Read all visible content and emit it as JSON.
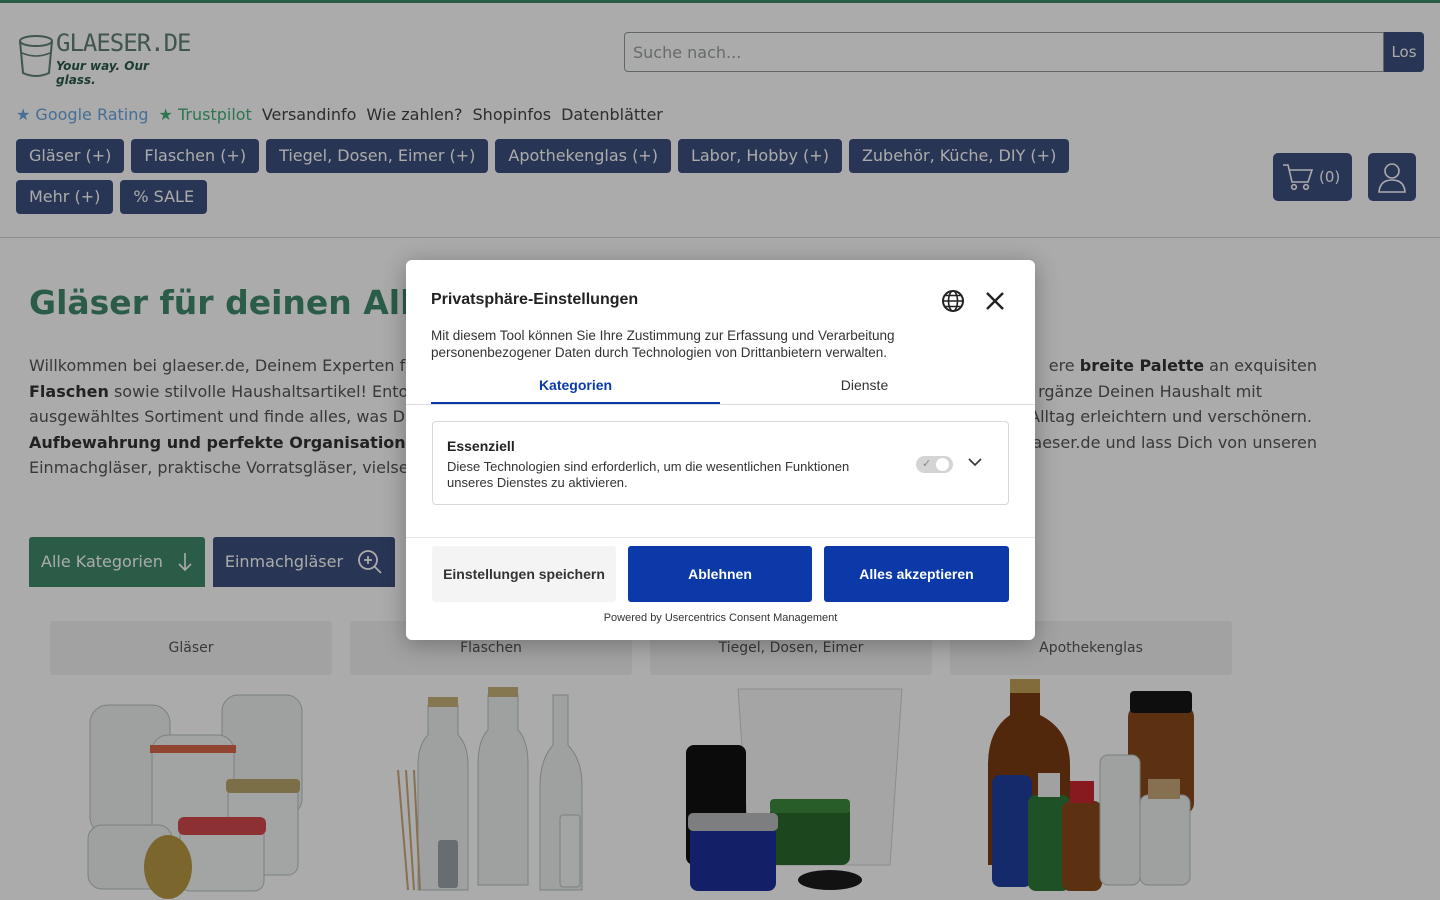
{
  "brand": {
    "name": "GLAESER.DE",
    "tagline": "Your way. Our glass."
  },
  "search": {
    "placeholder": "Suche nach...",
    "button": "Los"
  },
  "toplinks": [
    {
      "label": "★ Google Rating"
    },
    {
      "label": "★ Trustpilot"
    },
    {
      "label": "Versandinfo"
    },
    {
      "label": "Wie zahlen?"
    },
    {
      "label": "Shopinfos"
    },
    {
      "label": "Datenblätter"
    }
  ],
  "categories": [
    "Gläser (+)",
    "Flaschen (+)",
    "Tiegel, Dosen, Eimer (+)",
    "Apothekenglas (+)",
    "Labor, Hobby (+)",
    "Zubehör, Küche, DIY (+)",
    "Mehr (+)",
    "% SALE"
  ],
  "cart": {
    "count": "(0)"
  },
  "main": {
    "title": "Gläser für deinen Allta",
    "intro": {
      "l1a": "Willkommen bei glaeser.de, Deinem Experten f",
      "l1b": "ere ",
      "l1c": "breite Palette",
      "l1d": " an exquisiten",
      "l2a": "Flaschen",
      "l2b": " sowie stilvolle Haushaltsartikel! Ento",
      "l2c": "rgänze Deinen Haushalt mit",
      "l3a": "ausgewähltes Sortiment und finde alles, was D",
      "l3b": "Alltag erleichtern und verschönern.",
      "l4a": "Aufbewahrung und perfekte Organisation",
      "l4b": "aeser.de und lass Dich von unseren",
      "l5a": "Einmachgläser, praktische Vorratsgläser, vielse"
    },
    "tabs": {
      "all": "Alle Kategorien",
      "search": "Einmachgläser"
    },
    "tiles": [
      "Gläser",
      "Flaschen",
      "Tiegel, Dosen, Eimer",
      "Apothekenglas"
    ]
  },
  "consent": {
    "title": "Privatsphäre-Einstellungen",
    "description": "Mit diesem Tool können Sie Ihre Zustimmung zur Erfassung und Verarbeitung personenbezogener Daten durch Technologien von Drittanbietern verwalten.",
    "tab_categories": "Kategorien",
    "tab_services": "Dienste",
    "essential_title": "Essenziell",
    "essential_desc": "Diese Technologien sind erforderlich, um die wesentlichen Funktionen unseres Dienstes zu aktivieren.",
    "btn_save": "Einstellungen speichern",
    "btn_deny": "Ablehnen",
    "btn_accept": "Alles akzeptieren",
    "powered": "Powered by Usercentrics Consent Management"
  }
}
